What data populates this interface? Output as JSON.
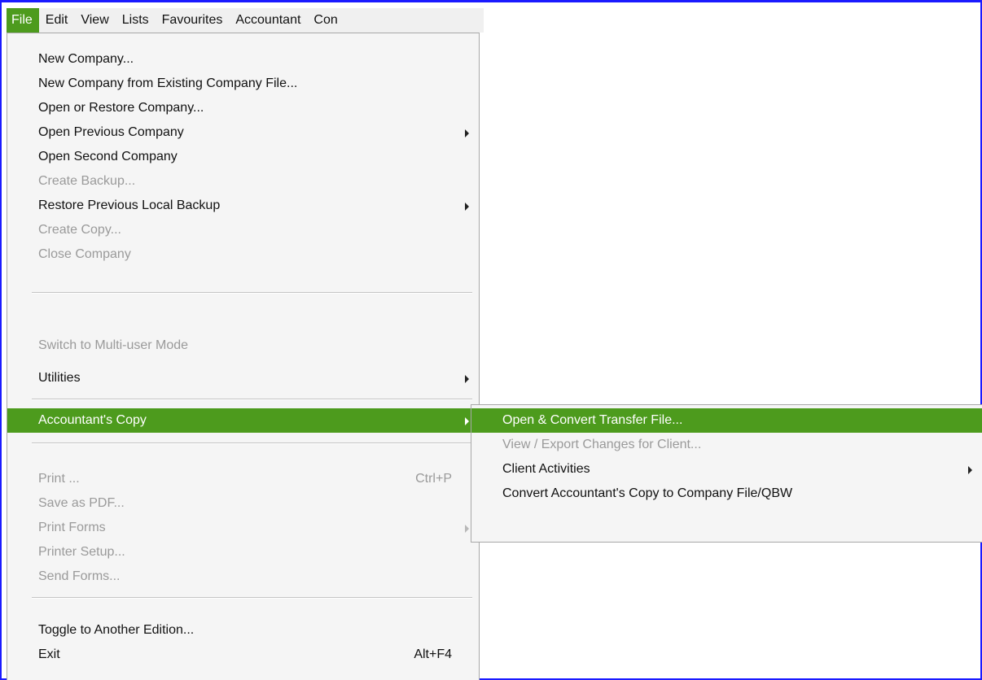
{
  "menubar": {
    "items": [
      {
        "label": "File"
      },
      {
        "label": "Edit"
      },
      {
        "label": "View"
      },
      {
        "label": "Lists"
      },
      {
        "label": "Favourites"
      },
      {
        "label": "Accountant"
      },
      {
        "label": "Con"
      }
    ]
  },
  "file_menu": {
    "items": [
      {
        "label": "New Company...",
        "enabled": true
      },
      {
        "label": "New Company from Existing Company File...",
        "enabled": true
      },
      {
        "label": "Open or Restore Company...",
        "enabled": true
      },
      {
        "label": "Open Previous Company",
        "enabled": true,
        "submenu": true
      },
      {
        "label": "Open Second Company",
        "enabled": true
      },
      {
        "label": "Create Backup...",
        "enabled": false
      },
      {
        "label": "Restore Previous Local Backup",
        "enabled": true,
        "submenu": true
      },
      {
        "label": "Create Copy...",
        "enabled": false
      },
      {
        "label": "Close Company",
        "enabled": false
      },
      {
        "label": "Switch to Multi-user Mode",
        "enabled": false
      },
      {
        "label": "Utilities",
        "enabled": true,
        "submenu": true
      },
      {
        "label": "Accountant's Copy",
        "enabled": true,
        "submenu": true,
        "highlighted": true
      },
      {
        "label": "Print ...",
        "shortcut": "Ctrl+P",
        "enabled": false
      },
      {
        "label": "Save as PDF...",
        "enabled": false
      },
      {
        "label": "Print Forms",
        "enabled": false,
        "submenu": true
      },
      {
        "label": "Printer Setup...",
        "enabled": false
      },
      {
        "label": "Send Forms...",
        "enabled": false
      },
      {
        "label": "Toggle to Another Edition...",
        "enabled": true
      },
      {
        "label": "Exit",
        "shortcut": "Alt+F4",
        "enabled": true
      }
    ]
  },
  "accountants_copy_submenu": {
    "items": [
      {
        "label": "Open & Convert Transfer File...",
        "enabled": true,
        "highlighted": true
      },
      {
        "label": "View / Export Changes for Client...",
        "enabled": false
      },
      {
        "label": "Client Activities",
        "enabled": true,
        "submenu": true
      },
      {
        "label": "Convert Accountant's Copy to Company File/QBW",
        "enabled": true
      }
    ]
  },
  "colors": {
    "highlight": "#4d9b1d",
    "menu_bg": "#f5f5f5",
    "disabled_text": "#9a9a9a",
    "frame_border": "#1a1aff"
  }
}
